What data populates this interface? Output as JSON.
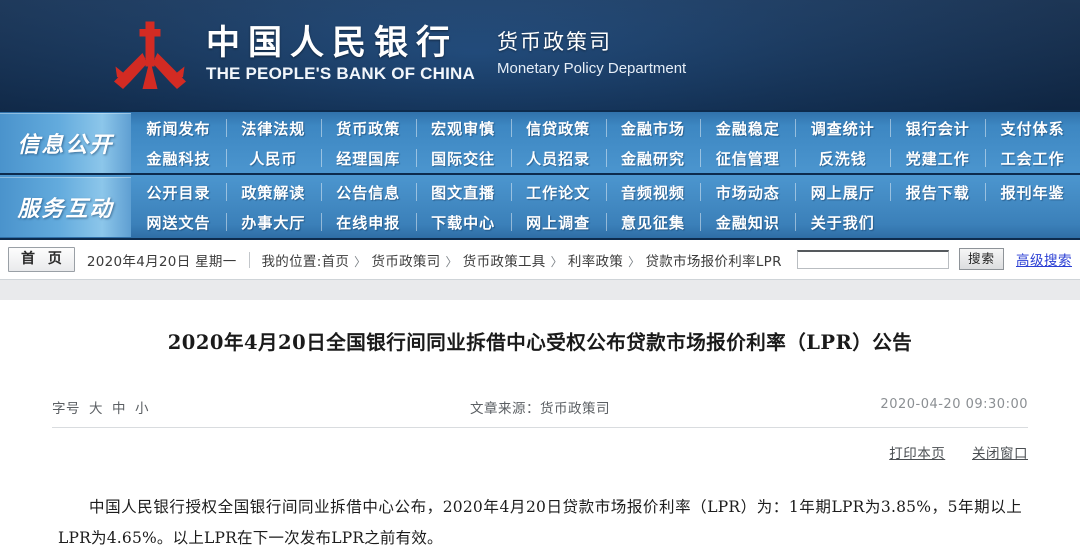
{
  "header": {
    "logo_icon": "pboc-emblem-icon",
    "title_cn": "中国人民银行",
    "title_en": "THE PEOPLE'S BANK OF CHINA",
    "dept_cn": "货币政策司",
    "dept_en": "Monetary Policy Department",
    "bg_color": "#16375f",
    "logo_color": "#d32b23"
  },
  "nav": {
    "accent_color": "#4c96cf",
    "sections": [
      {
        "label": "信息公开",
        "rows": [
          [
            "新闻发布",
            "法律法规",
            "货币政策",
            "宏观审慎",
            "信贷政策",
            "金融市场",
            "金融稳定",
            "调查统计",
            "银行会计",
            "支付体系"
          ],
          [
            "金融科技",
            "人民币",
            "经理国库",
            "国际交往",
            "人员招录",
            "金融研究",
            "征信管理",
            "反洗钱",
            "党建工作",
            "工会工作"
          ]
        ]
      },
      {
        "label": "服务互动",
        "rows": [
          [
            "公开目录",
            "政策解读",
            "公告信息",
            "图文直播",
            "工作论文",
            "音频视频",
            "市场动态",
            "网上展厅",
            "报告下载",
            "报刊年鉴"
          ],
          [
            "网送文告",
            "办事大厅",
            "在线申报",
            "下载中心",
            "网上调查",
            "意见征集",
            "金融知识",
            "关于我们",
            "",
            ""
          ]
        ]
      }
    ]
  },
  "crumbbar": {
    "home_label": "首 页",
    "date": "2020年4月20日  星期一",
    "position_label": "我的位置:",
    "separator": "〉",
    "path": [
      "首页",
      "货币政策司",
      "货币政策工具",
      "利率政策",
      "贷款市场报价利率LPR"
    ],
    "search": {
      "value": "",
      "placeholder": "",
      "button_label": "搜索",
      "advanced_label": "高级搜索",
      "link_color": "#2b3fd4"
    }
  },
  "article": {
    "title": "2020年4月20日全国银行间同业拆借中心受权公布贷款市场报价利率（LPR）公告",
    "fontsize_label": "字号",
    "fontsize_options": [
      "大",
      "中",
      "小"
    ],
    "source_label": "文章来源：货币政策司",
    "timestamp": "2020-04-20  09:30:00",
    "actions": [
      {
        "label": "打印本页",
        "name": "print-page-link"
      },
      {
        "label": "关闭窗口",
        "name": "close-window-link"
      }
    ],
    "body_paragraph": "中国人民银行授权全国银行间同业拆借中心公布，2020年4月20日贷款市场报价利率（LPR）为：1年期LPR为3.85%，5年期以上LPR为4.65%。以上LPR在下一次发布LPR之前有效。"
  }
}
